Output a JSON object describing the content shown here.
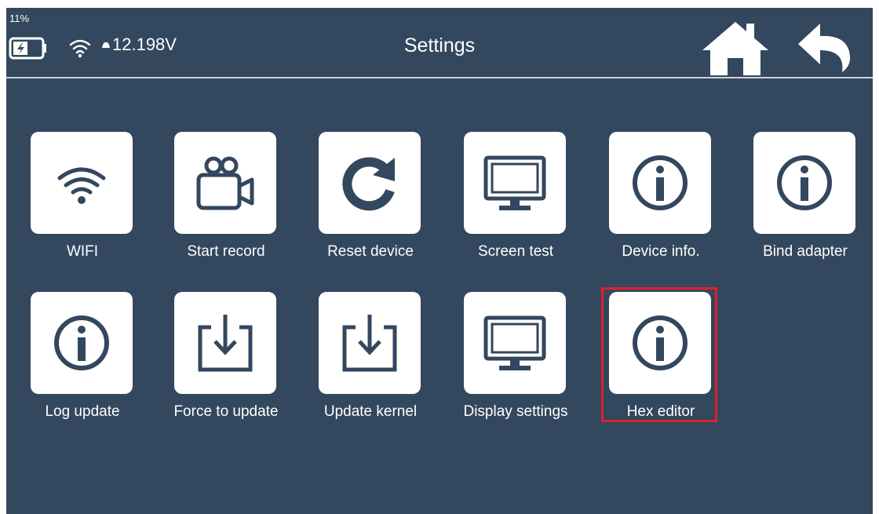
{
  "status_bar": {
    "battery_percent": "11%",
    "battery_icon": "battery-charging-icon",
    "wifi_icon": "wifi-icon",
    "voltage": "12.198V"
  },
  "header": {
    "title": "Settings",
    "home_icon": "home-icon",
    "back_icon": "back-arrow-icon"
  },
  "colors": {
    "background": "#33475e",
    "tile": "#ffffff",
    "icon": "#33475e",
    "highlight": "#e0202a"
  },
  "tiles": [
    {
      "label": "WIFI",
      "icon": "wifi-icon"
    },
    {
      "label": "Start record",
      "icon": "video-camera-icon"
    },
    {
      "label": "Reset device",
      "icon": "refresh-icon"
    },
    {
      "label": "Screen test",
      "icon": "monitor-icon"
    },
    {
      "label": "Device info.",
      "icon": "info-icon"
    },
    {
      "label": "Bind adapter",
      "icon": "info-icon"
    },
    {
      "label": "Log update",
      "icon": "info-icon"
    },
    {
      "label": "Force to update",
      "icon": "download-icon"
    },
    {
      "label": "Update kernel",
      "icon": "download-icon"
    },
    {
      "label": "Display settings",
      "icon": "monitor-icon"
    },
    {
      "label": "Hex editor",
      "icon": "info-icon",
      "highlighted": true
    }
  ]
}
